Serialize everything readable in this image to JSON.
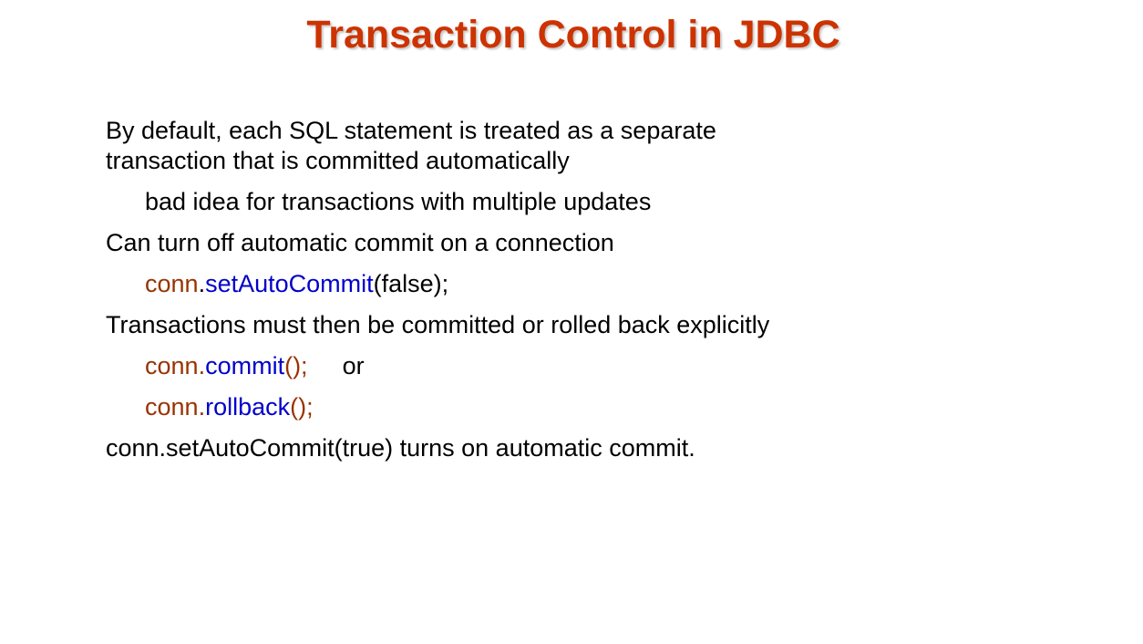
{
  "slide": {
    "title": "Transaction Control in JDBC",
    "title_color": "#cc3300",
    "bullets": [
      {
        "text_line1": "By default, each SQL statement is treated as a separate",
        "text_line2": "transaction that is committed automatically"
      },
      {
        "text": "bad idea for transactions with multiple updates"
      },
      {
        "text": "Can turn off automatic commit on a connection"
      },
      {
        "code": {
          "obj": "conn",
          "dot": ".",
          "method": "setAutoCommit",
          "args": "(false);"
        }
      },
      {
        "text": "Transactions must then be committed or rolled back explicitly"
      },
      {
        "code": {
          "obj": "conn",
          "dot": ".",
          "method": "commit",
          "args": "();",
          "suffix": "or"
        }
      },
      {
        "code": {
          "obj": "conn",
          "dot": ".",
          "method": "rollback",
          "args": "();"
        }
      },
      {
        "text": "conn.setAutoCommit(true) turns on automatic commit."
      }
    ],
    "colors": {
      "code_object": "#993300",
      "code_method": "#0000cc"
    }
  }
}
